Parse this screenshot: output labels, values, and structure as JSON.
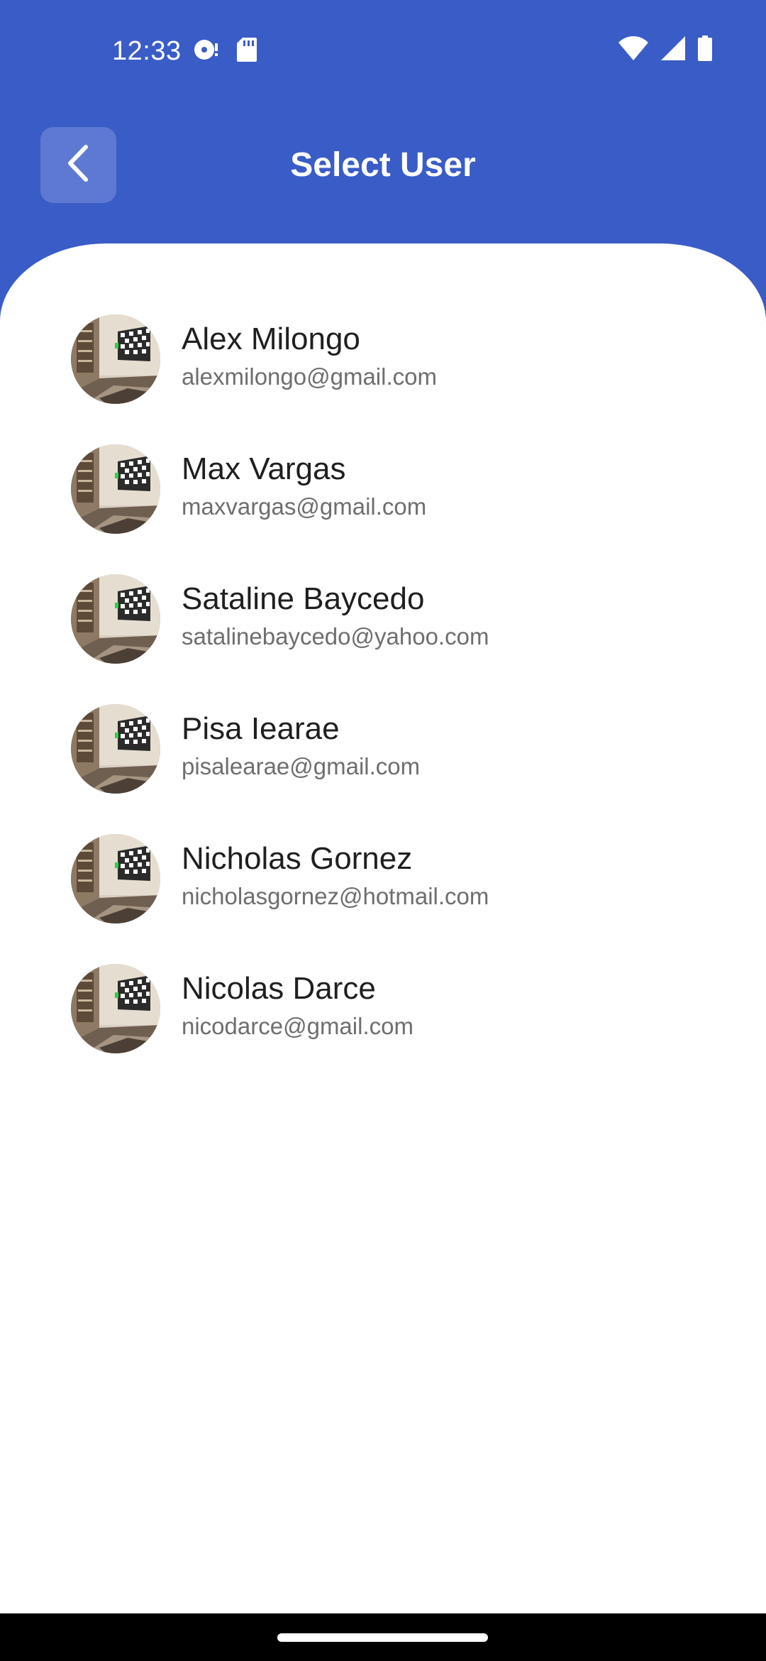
{
  "status_bar": {
    "time": "12:33",
    "left_icons": [
      "media-sync-icon",
      "sd-card-icon"
    ],
    "right_icons": [
      "wifi-icon",
      "cell-signal-icon",
      "battery-icon"
    ]
  },
  "header": {
    "title": "Select User",
    "back_icon": "chevron-left-icon"
  },
  "users": [
    {
      "name": "Alex Milongo",
      "email": "alexmilongo@gmail.com"
    },
    {
      "name": "Max Vargas",
      "email": "maxvargas@gmail.com"
    },
    {
      "name": "Sataline Baycedo",
      "email": "satalinebaycedo@yahoo.com"
    },
    {
      "name": "Pisa Iearae",
      "email": "pisalearae@gmail.com"
    },
    {
      "name": "Nicholas Gornez",
      "email": "nicholasgornez@hotmail.com"
    },
    {
      "name": "Nicolas Darce",
      "email": "nicodarce@gmail.com"
    }
  ],
  "colors": {
    "header_background": "#3a5cc7",
    "sheet_background": "#ffffff",
    "name_text": "#1f1f1f",
    "email_text": "#6e6e6e"
  }
}
